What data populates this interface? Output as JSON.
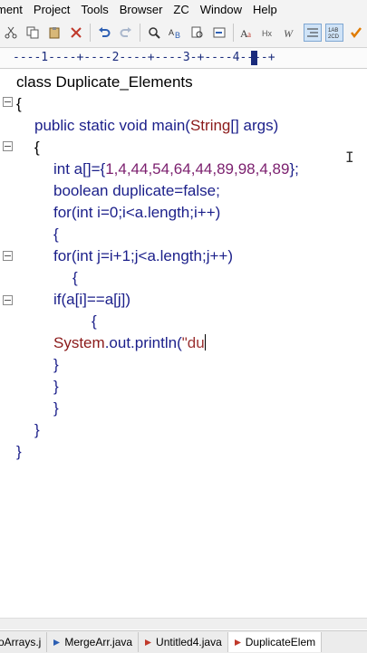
{
  "menu": [
    "ment",
    "Project",
    "Tools",
    "Browser",
    "ZC",
    "Window",
    "Help"
  ],
  "toolbar_icons": [
    "scissors-icon",
    "copy-icon",
    "paste-icon",
    "delete-icon",
    "undo-icon",
    "redo-icon",
    "find-icon",
    "replace-icon",
    "find-in-files-icon",
    "goto-icon",
    "font-case-icon",
    "hex-icon",
    "word-wrap-icon",
    "indent-icon",
    "line-numbers-icon",
    "spell-check-icon",
    "panel-icon"
  ],
  "ruler": {
    "text": "----1----+----2----+----3-+----4----+",
    "marks": [
      "1",
      "2",
      "3",
      "4"
    ]
  },
  "code_lines": [
    {
      "tokens": [
        [
          "class Duplicate_Elements",
          ""
        ]
      ]
    },
    {
      "tokens": [
        [
          "{",
          ""
        ]
      ]
    },
    {
      "tokens": [
        [
          "public static void main(",
          ""
        ],
        [
          "String",
          ""
        ],
        [
          "[] args)",
          ""
        ]
      ]
    },
    {
      "tokens": [
        [
          "{",
          ""
        ]
      ]
    },
    {
      "tokens": [
        [
          "int a[]={",
          ""
        ],
        [
          "1,4,44,54,64,44,89,98,4,89",
          ""
        ],
        [
          "};",
          ""
        ]
      ]
    },
    {
      "tokens": [
        [
          "boolean duplicate=false;",
          ""
        ]
      ]
    },
    {
      "tokens": [
        [
          "for(int i=0;i<a.length;i++)",
          ""
        ]
      ]
    },
    {
      "tokens": [
        [
          "{",
          ""
        ]
      ]
    },
    {
      "tokens": [
        [
          "for(int j=i+1;j<a.length;j++)",
          ""
        ]
      ]
    },
    {
      "tokens": [
        [
          "{",
          ""
        ]
      ]
    },
    {
      "tokens": [
        [
          "if(a[i]==a[j])",
          ""
        ]
      ]
    },
    {
      "tokens": [
        [
          "{",
          ""
        ]
      ]
    },
    {
      "tokens": [
        [
          "System",
          ""
        ],
        [
          ".out.println(",
          ""
        ],
        [
          "\"du",
          ""
        ]
      ]
    },
    {
      "tokens": [
        [
          "}",
          ""
        ]
      ]
    },
    {
      "tokens": [
        [
          "}",
          ""
        ]
      ]
    },
    {
      "tokens": [
        [
          "}",
          ""
        ]
      ]
    },
    {
      "tokens": [
        [
          "}",
          ""
        ]
      ]
    },
    {
      "tokens": [
        [
          "}",
          ""
        ]
      ]
    }
  ],
  "tabs": [
    "oArrays.j",
    "MergeArr.java",
    "Untitled4.java",
    "DuplicateElem"
  ],
  "colors": {
    "keyword": "#1b1f8a",
    "type": "#8b1a1a",
    "number": "#7b1f6e",
    "string": "#9b3232",
    "ruler": "#1a2b7c"
  }
}
